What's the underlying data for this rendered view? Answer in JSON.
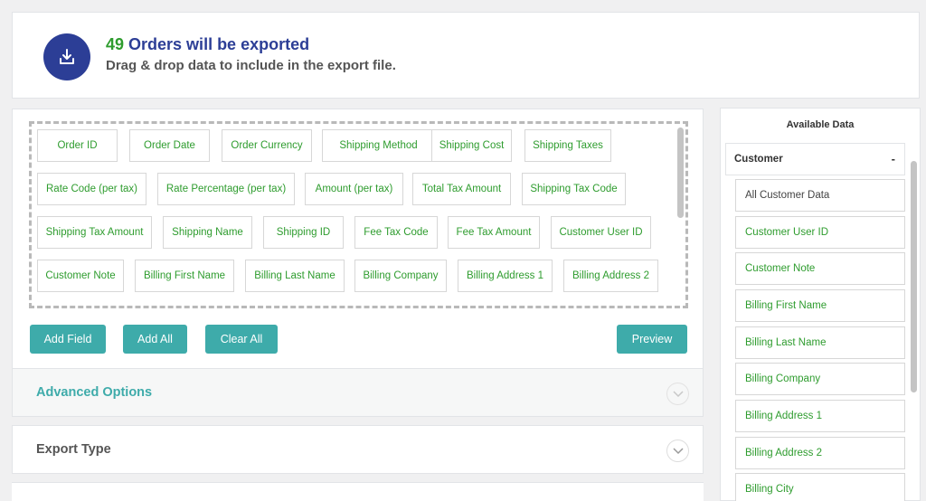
{
  "header": {
    "count": "49",
    "count_suffix": " Orders will be exported",
    "subtitle": "Drag & drop data to include in the export file."
  },
  "fields": [
    "Order ID",
    "Order Date",
    "Order Currency",
    "Shipping Method",
    "Shipping Cost",
    "Shipping Taxes",
    "Rate Code (per tax)",
    "Rate Percentage (per tax)",
    "Amount (per tax)",
    "Total Tax Amount",
    "Shipping Tax Code",
    "Shipping Tax Amount",
    "Shipping Name",
    "Shipping ID",
    "Fee Tax Code",
    "Fee Tax Amount",
    "Customer User ID",
    "Customer Note",
    "Billing First Name",
    "Billing Last Name",
    "Billing Company",
    "Billing Address 1",
    "Billing Address 2"
  ],
  "buttons": {
    "add_field": "Add Field",
    "add_all": "Add All",
    "clear_all": "Clear All",
    "preview": "Preview"
  },
  "accordions": {
    "advanced": "Advanced Options",
    "export_type": "Export Type"
  },
  "side_panel": {
    "title": "Available Data",
    "group_label": "Customer",
    "group_toggle": "-",
    "items": [
      "All Customer Data",
      "Customer User ID",
      "Customer Note",
      "Billing First Name",
      "Billing Last Name",
      "Billing Company",
      "Billing Address 1",
      "Billing Address 2",
      "Billing City"
    ]
  },
  "colors": {
    "accent": "#3eabaa",
    "brand": "#2c3e96",
    "field_green": "#2e9c2e"
  },
  "icons": [
    "export-download-icon",
    "chevron-down-icon"
  ]
}
